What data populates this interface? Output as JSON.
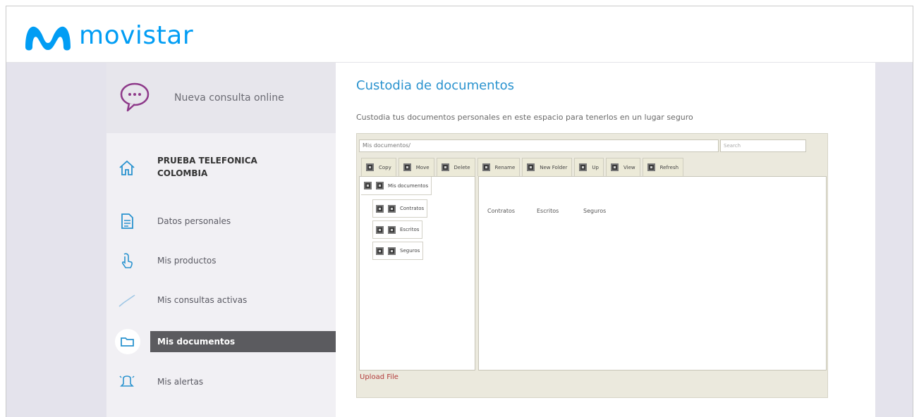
{
  "brand": {
    "name": "movistar",
    "color": "#019df4"
  },
  "sidebar": {
    "consult_label": "Nueva consulta online",
    "account_name": "PRUEBA TELEFONICA COLOMBIA",
    "items": [
      {
        "label": "Datos personales",
        "icon": "document-icon"
      },
      {
        "label": "Mis productos",
        "icon": "hand-icon"
      },
      {
        "label": "Mis consultas activas",
        "icon": "check-icon"
      },
      {
        "label": "Mis documentos",
        "icon": "folder-icon",
        "active": true
      },
      {
        "label": "Mis alertas",
        "icon": "alert-icon"
      }
    ]
  },
  "content": {
    "title": "Custodia de documentos",
    "description": "Custodia tus documentos personales en este espacio para tenerlos en un lugar seguro"
  },
  "file_manager": {
    "path_value": "Mis documentos/",
    "search_placeholder": "Search",
    "toolbar": [
      "Copy",
      "Move",
      "Delete",
      "Rename",
      "New Folder",
      "Up",
      "View",
      "Refresh"
    ],
    "tree_root": "Mis documentos",
    "tree_children": [
      "Contratos",
      "Escritos",
      "Seguros"
    ],
    "files": [
      "Contratos",
      "Escritos",
      "Seguros"
    ],
    "upload_label": "Upload File"
  },
  "colors": {
    "accent": "#2a93cf",
    "sidebar_active": "#5b5b5f",
    "upload": "#b23a3a"
  }
}
